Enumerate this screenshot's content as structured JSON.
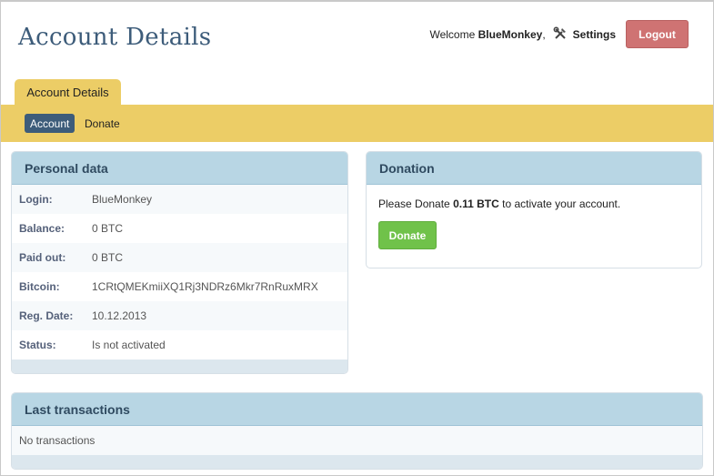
{
  "page": {
    "title": "Account Details"
  },
  "header": {
    "welcome_prefix": "Welcome",
    "username": "BlueMonkey",
    "welcome_suffix": ",",
    "settings_label": "Settings",
    "logout_label": "Logout"
  },
  "tabs": [
    {
      "label": "Account Details"
    }
  ],
  "subnav": {
    "active": "Account",
    "other": "Donate"
  },
  "personal": {
    "title": "Personal data",
    "rows": [
      {
        "key": "Login:",
        "value": "BlueMonkey"
      },
      {
        "key": "Balance:",
        "value": "0 BTC"
      },
      {
        "key": "Paid out:",
        "value": "0 BTC"
      },
      {
        "key": "Bitcoin:",
        "value": "1CRtQMEKmiiXQ1Rj3NDRz6Mkr7RnRuxMRX"
      },
      {
        "key": "Reg. Date:",
        "value": "10.12.2013"
      },
      {
        "key": "Status:",
        "value": "Is not activated"
      }
    ]
  },
  "donation": {
    "title": "Donation",
    "text_before": "Please Donate",
    "amount": "0.11 BTC",
    "text_after": "to activate your account.",
    "button_label": "Donate"
  },
  "transactions": {
    "title": "Last transactions",
    "empty_text": "No transactions"
  },
  "colors": {
    "accent": "#3d5c7a",
    "tab_yellow": "#eccd66",
    "panel_header": "#b8d6e4",
    "logout": "#cf7373",
    "donate": "#70c24a"
  }
}
